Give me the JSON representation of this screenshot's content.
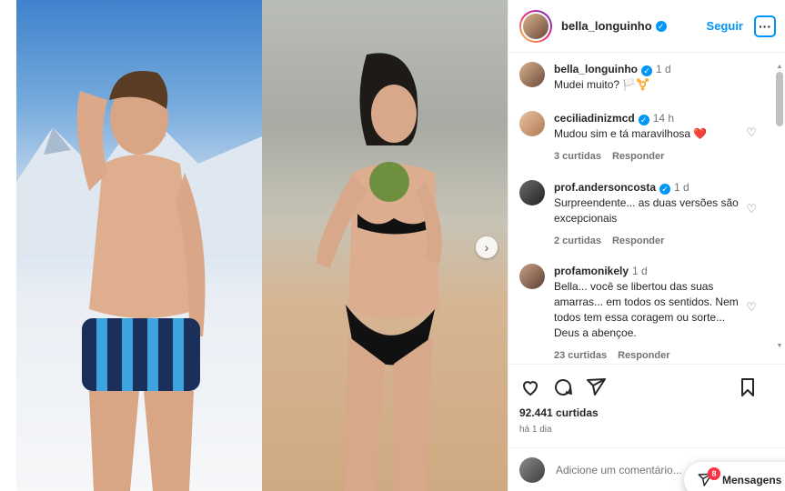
{
  "post": {
    "author": "bella_longuinho",
    "follow_label": "Seguir",
    "more_label": "···",
    "next_arrow": "›"
  },
  "caption": {
    "user": "bella_longuinho",
    "time": "1 d",
    "text": "Mudei muito? 🏳️⚧️"
  },
  "comments": [
    {
      "user": "ceciliadinizmcd",
      "verified": true,
      "time": "14 h",
      "text": "Mudou sim e tá maravilhosa ❤️",
      "likes": "3 curtidas",
      "reply": "Responder"
    },
    {
      "user": "prof.andersoncosta",
      "verified": true,
      "time": "1 d",
      "text": "Surpreendente... as duas versões são excepcionais",
      "likes": "2 curtidas",
      "reply": "Responder"
    },
    {
      "user": "profamonikely",
      "verified": false,
      "time": "1 d",
      "text": "Bella... você se libertou das suas amarras... em todos os sentidos. Nem todos tem essa coragem ou sorte... Deus a abençoe.",
      "likes": "23 curtidas",
      "reply": "Responder"
    }
  ],
  "stats": {
    "likes": "92.441 curtidas",
    "date": "há 1 dia"
  },
  "add_comment": {
    "placeholder": "Adicione um comentário..."
  },
  "messages": {
    "label": "Mensagens",
    "badge": "8"
  },
  "icons": [
    "heart-icon",
    "comment-icon",
    "share-icon",
    "bookmark-icon",
    "verified-icon",
    "chevron-right-icon",
    "more-icon",
    "messages-icon"
  ],
  "colors": {
    "accent": "#0095f6",
    "badge": "#ff3040",
    "text": "#262626",
    "muted": "#737373"
  }
}
